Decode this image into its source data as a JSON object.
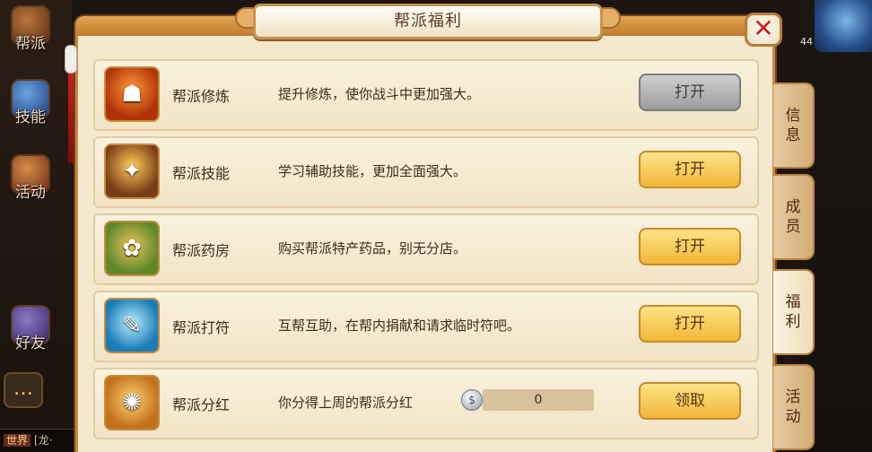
{
  "left_hud": {
    "items": [
      {
        "label": "帮派",
        "icon": "gang-banner-icon"
      },
      {
        "label": "技能",
        "icon": "skill-book-icon"
      },
      {
        "label": "活动",
        "icon": "activity-horn-icon"
      },
      {
        "label": "好友",
        "icon": "friends-hat-icon"
      }
    ],
    "chat_prefix": "世界",
    "chat_text": "[龙·"
  },
  "right_hud": {
    "level": "44"
  },
  "panel": {
    "title": "帮派福利",
    "close_glyph": "✕"
  },
  "welfare_items": [
    {
      "name": "帮派修炼",
      "description": "提升修炼，使你战斗中更加强大。",
      "button": "打开",
      "button_state": "disabled",
      "icon": "cultivate-icon"
    },
    {
      "name": "帮派技能",
      "description": "学习辅助技能，更加全面强大。",
      "button": "打开",
      "button_state": "enabled",
      "icon": "skill-icon"
    },
    {
      "name": "帮派药房",
      "description": "购买帮派特产药品，别无分店。",
      "button": "打开",
      "button_state": "enabled",
      "icon": "pharmacy-icon"
    },
    {
      "name": "帮派打符",
      "description": "互帮互助，在帮内捐献和请求临时符吧。",
      "button": "打开",
      "button_state": "enabled",
      "icon": "talisman-icon"
    },
    {
      "name": "帮派分红",
      "description": "你分得上周的帮派分红",
      "dividend_value": "0",
      "button": "领取",
      "button_state": "enabled",
      "icon": "dividend-icon"
    }
  ],
  "side_tabs": [
    {
      "label": "信息"
    },
    {
      "label": "成员"
    },
    {
      "label": "福利",
      "active": true
    },
    {
      "label": "活动"
    }
  ]
}
